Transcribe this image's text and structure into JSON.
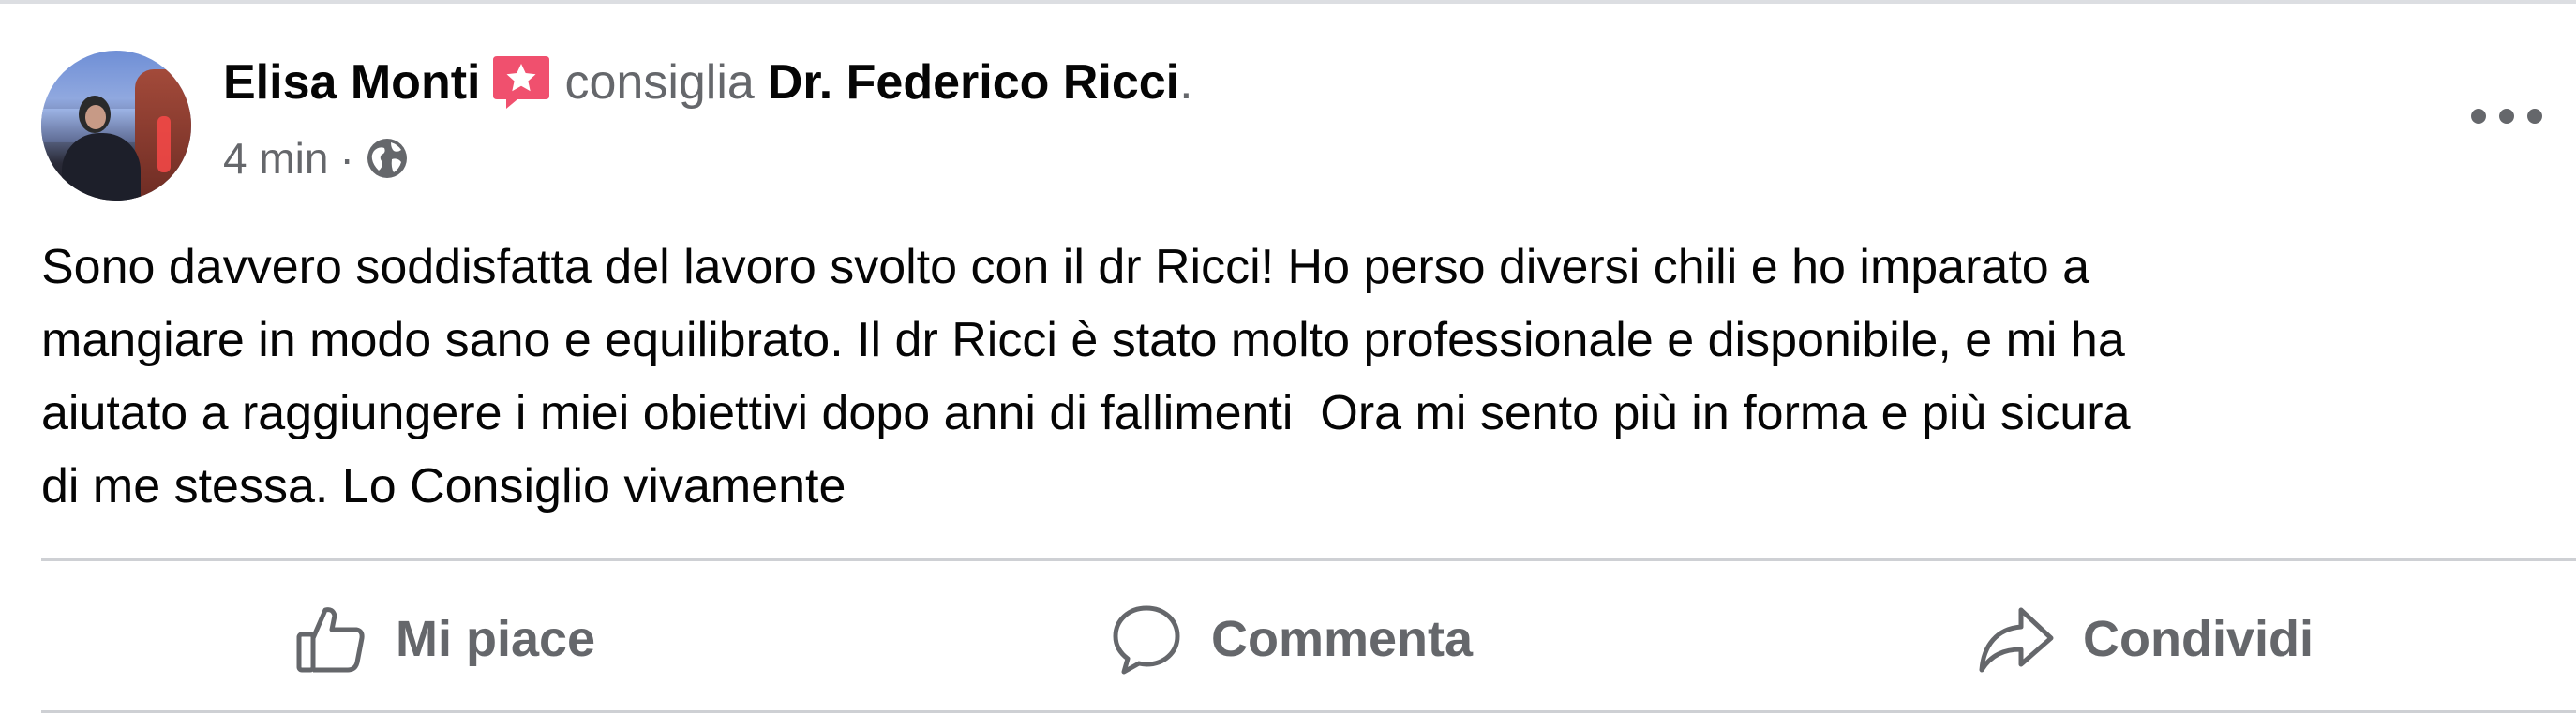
{
  "post": {
    "author": "Elisa Monti",
    "verb": "consiglia",
    "target": "Dr. Federico Ricci",
    "target_suffix": ".",
    "time": "4 min",
    "separator": "·",
    "visibility_icon": "globe-icon",
    "recommend_icon": "star-speech-bubble-icon",
    "recommend_icon_color": "#f0506e",
    "more_icon": "more-horizontal-icon",
    "body": "Sono davvero soddisfatta del lavoro svolto con il dr Ricci! Ho perso diversi chili e ho imparato a\nmangiare in modo sano e equilibrato. Il dr Ricci è stato molto professionale e disponibile, e mi ha\naiutato a raggiungere i miei obiettivi dopo anni di fallimenti  Ora mi sento più in forma e più sicura\ndi me stessa. Lo Consiglio vivamente"
  },
  "actions": {
    "like": {
      "label": "Mi piace",
      "icon": "thumbs-up-icon"
    },
    "comment": {
      "label": "Commenta",
      "icon": "comment-bubble-icon"
    },
    "share": {
      "label": "Condividi",
      "icon": "share-arrow-icon"
    }
  },
  "colors": {
    "primary_text": "#050505",
    "secondary_text": "#65676b",
    "divider": "#ced0d4"
  }
}
